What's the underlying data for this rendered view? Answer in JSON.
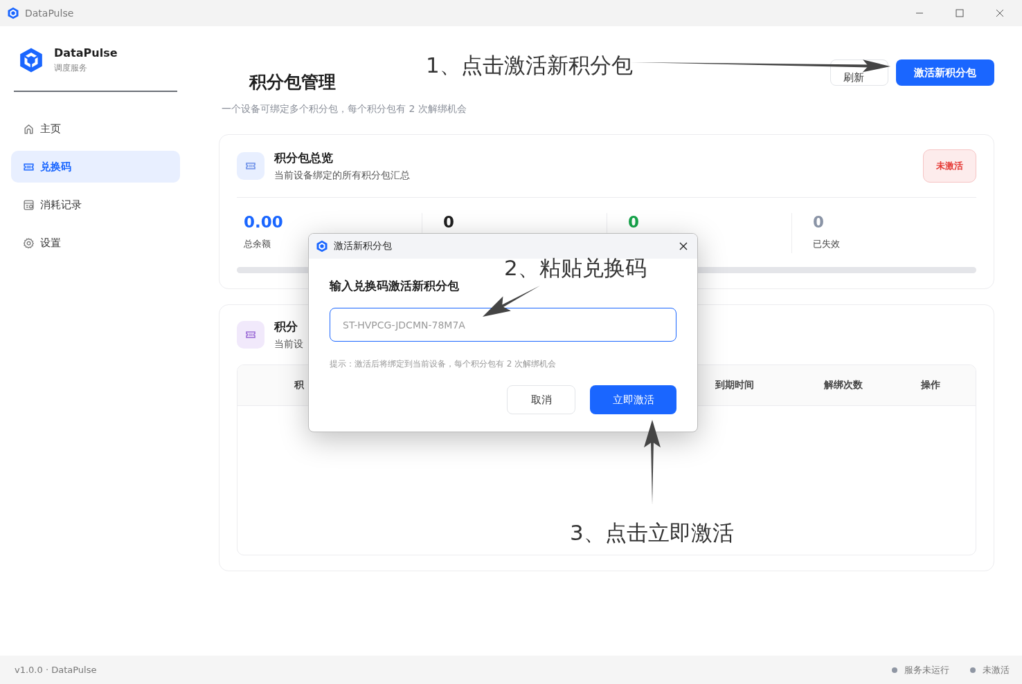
{
  "window": {
    "title": "DataPulse"
  },
  "sidebar": {
    "brand": "DataPulse",
    "subtitle": "调度服务",
    "items": [
      {
        "label": "主页",
        "selected": false
      },
      {
        "label": "兑换码",
        "selected": true
      },
      {
        "label": "消耗记录",
        "selected": false
      },
      {
        "label": "设置",
        "selected": false
      }
    ]
  },
  "header": {
    "title": "积分包管理",
    "subtitle": "一个设备可绑定多个积分包，每个积分包有 2 次解绑机会",
    "buttons": [
      {
        "label": "刷新",
        "kind": "secondary"
      },
      {
        "label": "激活新积分包",
        "kind": "primary"
      }
    ]
  },
  "overview": {
    "title": "积分包总览",
    "subtitle": "当前设备绑定的所有积分包汇总",
    "badge": "未激活",
    "stats": [
      {
        "value": "0.00",
        "label": "总余额",
        "color": "#1a66ff"
      },
      {
        "value": "0",
        "color": "#1f1f1f"
      },
      {
        "value": "0",
        "color": "#16a34a"
      },
      {
        "value": "0",
        "label": "已失效",
        "color": "#8a94a6"
      }
    ],
    "level": 0
  },
  "packages": {
    "title": "积分",
    "subtitle": "当前设",
    "columns": [
      "积",
      "到期时间",
      "解绑次数",
      "操作"
    ]
  },
  "dialog": {
    "title": "激活新积分包",
    "heading": "输入兑换码激活新积分包",
    "placeholder": "ST-HVPCG-JDCMN-78M7A",
    "hint": "提示：激活后将绑定到当前设备，每个积分包有 2 次解绑机会",
    "buttons": [
      {
        "label": "取消",
        "kind": "secondary"
      },
      {
        "label": "立即激活",
        "kind": "primary"
      }
    ]
  },
  "annotations": [
    "1、点击激活新积分包",
    "2、粘贴兑换码",
    "3、点击立即激活"
  ],
  "status_bar": {
    "version": "v1.0.0 · DataPulse",
    "items": [
      "服务未运行",
      "未激活"
    ]
  }
}
